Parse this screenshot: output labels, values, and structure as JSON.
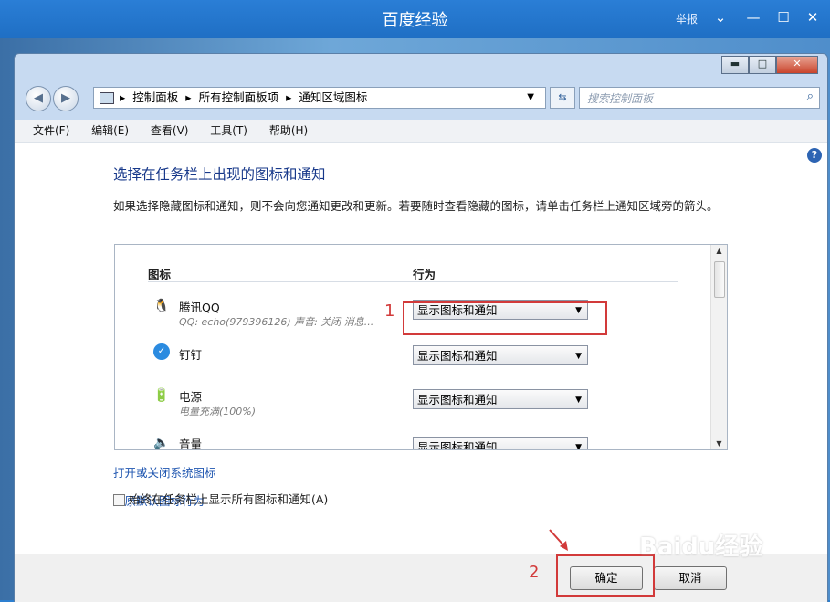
{
  "browser": {
    "title": "百度经验",
    "report": "举报"
  },
  "window": {
    "address": [
      "控制面板",
      "所有控制面板项",
      "通知区域图标"
    ],
    "search_placeholder": "搜索控制面板",
    "menu": [
      "文件(F)",
      "编辑(E)",
      "查看(V)",
      "工具(T)",
      "帮助(H)"
    ],
    "heading": "选择在任务栏上出现的图标和通知",
    "description": "如果选择隐藏图标和通知，则不会向您通知更改和更新。若要随时查看隐藏的图标，请单击任务栏上通知区域旁的箭头。",
    "columns": {
      "icon": "图标",
      "behavior": "行为"
    },
    "rows": [
      {
        "name": "腾讯QQ",
        "sub": "QQ: echo(979396126)  声音: 关闭  消息...",
        "value": "显示图标和通知",
        "icon": "qq-penguin-icon"
      },
      {
        "name": "钉钉",
        "sub": "",
        "value": "显示图标和通知",
        "icon": "dingtalk-icon"
      },
      {
        "name": "电源",
        "sub": "电量充满(100%)",
        "value": "显示图标和通知",
        "icon": "power-icon"
      },
      {
        "name": "音量",
        "sub": "",
        "value": "显示图标和通知",
        "icon": "volume-icon"
      }
    ],
    "links": [
      "打开或关闭系统图标",
      "还原默认图标行为"
    ],
    "checkbox_label": "始终在任务栏上显示所有图标和通知(A)",
    "ok": "确定",
    "cancel": "取消"
  },
  "annotations": {
    "one": "1",
    "two": "2"
  },
  "watermark": "Baidu经验",
  "colors": {
    "accent": "#1f6fc4",
    "annotation": "#d23a3a",
    "link": "#1f56b0"
  }
}
